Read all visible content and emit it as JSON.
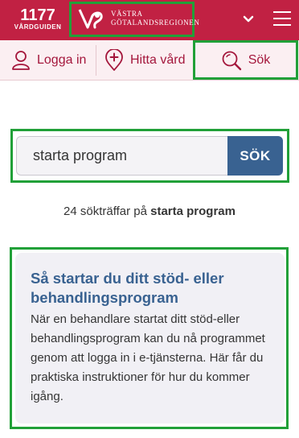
{
  "header": {
    "logo_number": "1177",
    "logo_sub": "VÅRDGUIDEN",
    "region_line1": "VÄSTRA",
    "region_line2": "GÖTALANDSREGIONEN",
    "icons": [
      "chevron-down-icon",
      "hamburger-menu-icon"
    ],
    "brand_color": "#c12143"
  },
  "nav": {
    "login_label": "Logga in",
    "find_care_label": "Hitta vård",
    "search_label": "Sök",
    "accent_color": "#a4173c"
  },
  "search": {
    "value": "starta program",
    "button_label": "SÖK"
  },
  "results": {
    "count_prefix": "24 sökträffar på",
    "query": "starta program"
  },
  "result_card": {
    "title": "Så startar du ditt stöd- eller behandlingsprogram",
    "text": "När en behandlare startat ditt stöd-eller behandlingsprogram kan du nå programmet genom att logga in i e-tjänsterna. Här får du praktiska instruktioner för hur du kommer igång."
  }
}
